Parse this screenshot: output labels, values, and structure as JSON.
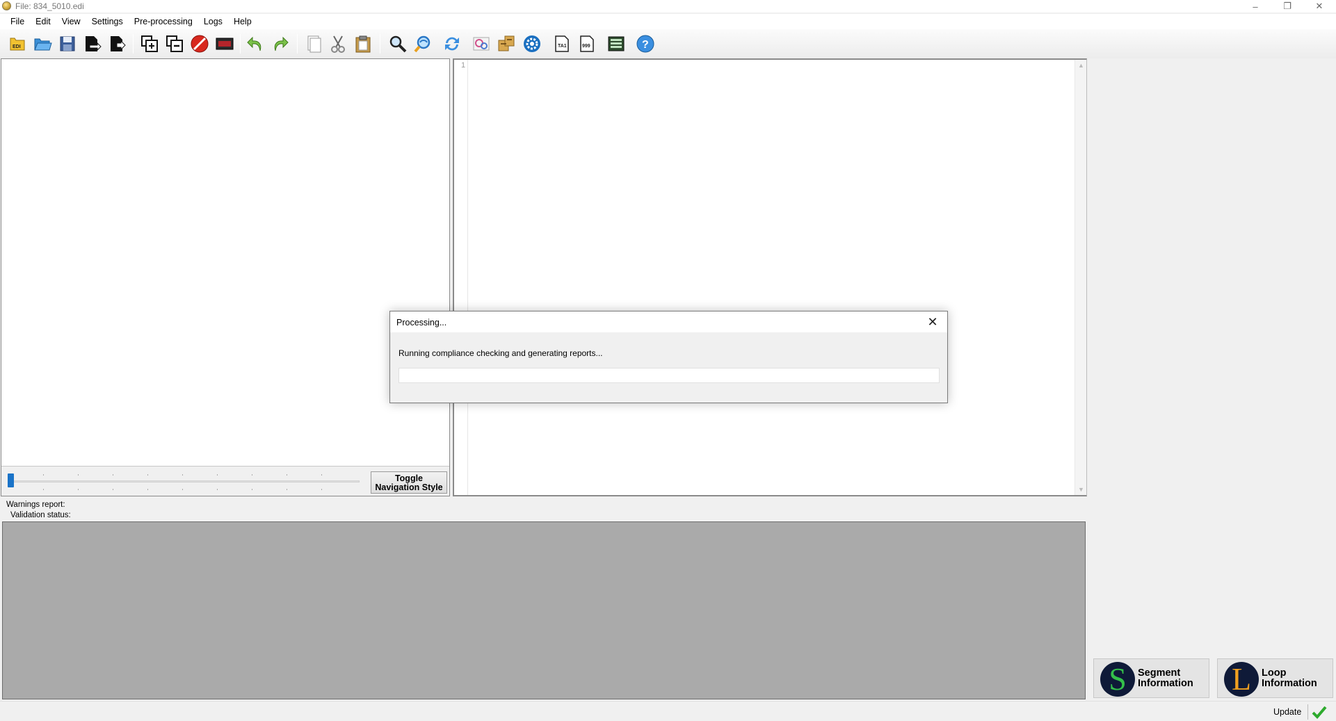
{
  "window": {
    "title": "File: 834_5010.edi",
    "minimize_glyph": "–",
    "maximize_glyph": "❐",
    "close_glyph": "✕"
  },
  "menu": [
    "File",
    "Edit",
    "View",
    "Settings",
    "Pre-processing",
    "Logs",
    "Help"
  ],
  "toolbar_icons": [
    "new-edi-icon",
    "open-folder-icon",
    "save-icon",
    "export-icon",
    "export-as-icon",
    "add-segment-icon",
    "remove-segment-icon",
    "stop-icon",
    "dark-toggle-icon",
    "undo-icon",
    "redo-icon",
    "copy-icon",
    "cut-icon",
    "paste-icon",
    "search-icon",
    "find-replace-icon",
    "refresh-icon",
    "settings-gallery-icon",
    "preprocess-icon",
    "gear-icon",
    "ta1-icon",
    "999-icon",
    "report-icon",
    "help-icon"
  ],
  "nav_panel": {
    "toggle_label_line1": "Toggle",
    "toggle_label_line2": "Navigation Style",
    "slider_value": 0
  },
  "editor": {
    "first_line_number": "1"
  },
  "reports": {
    "warnings_label": "Warnings report:",
    "validation_label": "Validation status:"
  },
  "info_buttons": {
    "segment": {
      "letter": "S",
      "line1": "Segment",
      "line2": "Information"
    },
    "loop": {
      "letter": "L",
      "line1": "Loop",
      "line2": "Information"
    }
  },
  "status_bar": {
    "update_label": "Update"
  },
  "dialog": {
    "title": "Processing...",
    "message": "Running compliance checking and generating reports...",
    "progress_percent": 0,
    "close_glyph": "✕"
  },
  "colors": {
    "accent_blue": "#1a73c8",
    "report_gray": "#aaaaaa",
    "segment_letter": "#34c04a",
    "loop_letter": "#f0a020",
    "badge_bg": "#0f1a38",
    "check_green": "#2eaa2e"
  }
}
